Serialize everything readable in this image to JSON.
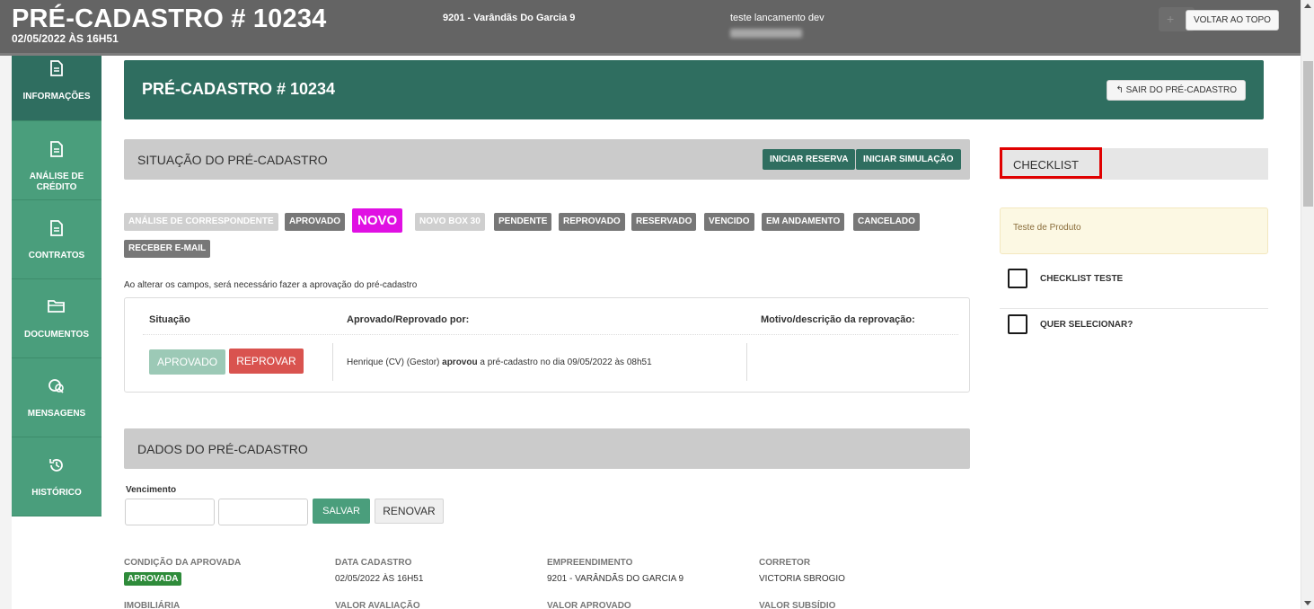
{
  "header_overlay": {
    "title": "PRÉ-CADASTRO # 10234",
    "date": "02/05/2022 ÀS 16H51",
    "project": "9201 - Varândãs Do Garcia 9",
    "user": "teste lancamento dev",
    "back_to_top_label": "VOLTAR AO TOPO"
  },
  "sidebar": {
    "items": [
      {
        "label": "INFORMAÇÕES",
        "icon": "document-icon"
      },
      {
        "label": "ANÁLISE DE CRÉDITO",
        "icon": "document-icon"
      },
      {
        "label": "CONTRATOS",
        "icon": "document-icon"
      },
      {
        "label": "DOCUMENTOS",
        "icon": "folder-icon"
      },
      {
        "label": "MENSAGENS",
        "icon": "chat-icon"
      },
      {
        "label": "HISTÓRICO",
        "icon": "history-icon"
      }
    ]
  },
  "page_title": {
    "title": "PRÉ-CADASTRO # 10234",
    "exit_label": "SAIR DO PRÉ-CADASTRO"
  },
  "situacao": {
    "title": "SITUAÇÃO DO PRÉ-CADASTRO",
    "btn_reserva": "INICIAR RESERVA",
    "btn_simulacao": "INICIAR SIMULAÇÃO",
    "tags": [
      "ANÁLISE DE CORRESPONDENTE",
      "APROVADO",
      "NOVO",
      "NOVO BOX 30",
      "PENDENTE",
      "REPROVADO",
      "RESERVADO",
      "VENCIDO",
      "EM ANDAMENTO",
      "CANCELADO",
      "RECEBER E-MAIL"
    ],
    "note": "Ao alterar os campos, será necessário fazer a aprovação do pré-cadastro",
    "col_situacao": "Situação",
    "col_aprovado_por": "Aprovado/Reprovado por:",
    "col_motivo": "Motivo/descrição da reprovação:",
    "btn_aprovado": "APROVADO",
    "btn_reprovar": "REPROVAR",
    "approval_who": "Henrique (CV) (Gestor)",
    "approval_action": "aprovou",
    "approval_rest": "a pré-cadastro no dia 09/05/2022 às 08h51"
  },
  "dados": {
    "title": "DADOS DO PRÉ-CADASTRO",
    "vencimento_label": "Vencimento",
    "btn_salvar": "SALVAR",
    "btn_renovar": "RENOVAR",
    "fields": [
      {
        "label": "CONDIÇÃO DA APROVADA",
        "value": "APROVADA"
      },
      {
        "label": "DATA CADASTRO",
        "value": "02/05/2022 ÀS 16H51"
      },
      {
        "label": "EMPREENDIMENTO",
        "value": "9201 - VARÂNDÃS DO GARCIA 9"
      },
      {
        "label": "CORRETOR",
        "value": "VICTORIA SBROGIO"
      },
      {
        "label": "IMOBILIÁRIA",
        "value": ""
      },
      {
        "label": "VALOR AVALIAÇÃO",
        "value": ""
      },
      {
        "label": "VALOR APROVADO",
        "value": ""
      },
      {
        "label": "VALOR SUBSÍDIO",
        "value": ""
      }
    ]
  },
  "checklist": {
    "title": "CHECKLIST",
    "note": "Teste de Produto",
    "items": [
      {
        "label": "CHECKLIST TESTE",
        "checked": false
      },
      {
        "label": "QUER SELECIONAR?",
        "checked": false
      }
    ]
  },
  "colors": {
    "dark_green": "#2f6e60",
    "nav_green": "#4a9e7c",
    "novo_magenta": "#e010e3",
    "reprovar_red": "#d9534f",
    "highlight_red": "#e00000"
  }
}
